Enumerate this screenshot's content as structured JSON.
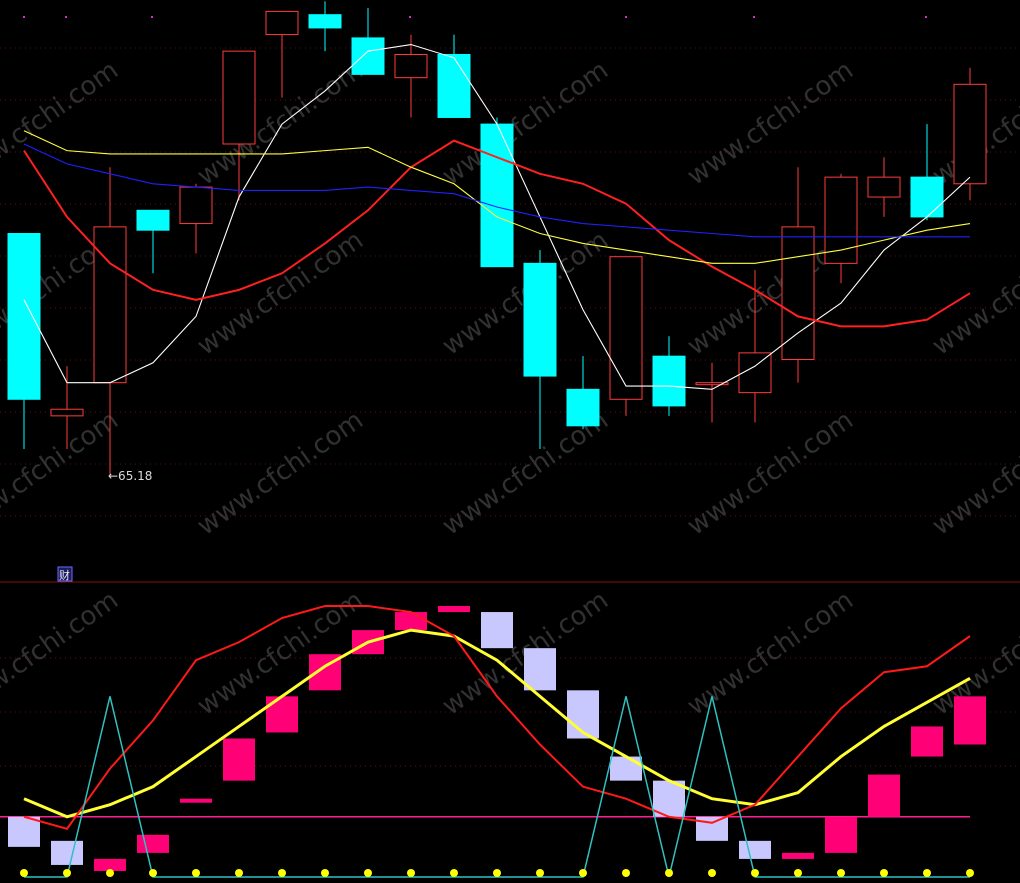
{
  "chart_data": [
    {
      "type": "candlestick",
      "annotation": "←65.18",
      "badge": "财",
      "low_marker": 65.18,
      "ylim": [
        62.2,
        79.0
      ],
      "up_color": "#ff3c3c",
      "down_color": "#00ffff",
      "candles": [
        {
          "o": 72.5,
          "h": 72.5,
          "l": 66.0,
          "c": 67.5
        },
        {
          "o": 67.0,
          "h": 68.5,
          "l": 66.0,
          "c": 67.2
        },
        {
          "o": 68.0,
          "h": 74.5,
          "l": 65.2,
          "c": 72.7
        },
        {
          "o": 73.2,
          "h": 73.2,
          "l": 71.3,
          "c": 72.6
        },
        {
          "o": 72.8,
          "h": 74.0,
          "l": 71.9,
          "c": 73.9
        },
        {
          "o": 75.2,
          "h": 76.4,
          "l": 73.5,
          "c": 78.0
        },
        {
          "o": 78.5,
          "h": 79.0,
          "l": 76.6,
          "c": 79.2
        },
        {
          "o": 79.1,
          "h": 79.5,
          "l": 78.0,
          "c": 78.7
        },
        {
          "o": 78.4,
          "h": 79.3,
          "l": 77.5,
          "c": 77.3
        },
        {
          "o": 77.2,
          "h": 78.5,
          "l": 76.0,
          "c": 77.9
        },
        {
          "o": 77.9,
          "h": 78.5,
          "l": 76.5,
          "c": 76.0
        },
        {
          "o": 75.8,
          "h": 76.0,
          "l": 71.5,
          "c": 71.5
        },
        {
          "o": 71.6,
          "h": 72.0,
          "l": 66.0,
          "c": 68.2
        },
        {
          "o": 67.8,
          "h": 68.8,
          "l": 66.6,
          "c": 66.7
        },
        {
          "o": 67.5,
          "h": 71.8,
          "l": 67.0,
          "c": 71.8
        },
        {
          "o": 68.8,
          "h": 69.4,
          "l": 67.0,
          "c": 67.3
        },
        {
          "o": 68.0,
          "h": 68.6,
          "l": 66.8,
          "c": 68.0
        },
        {
          "o": 67.7,
          "h": 71.4,
          "l": 66.8,
          "c": 68.9
        },
        {
          "o": 68.7,
          "h": 74.5,
          "l": 68.0,
          "c": 72.7
        },
        {
          "o": 71.6,
          "h": 74.3,
          "l": 71.0,
          "c": 74.2
        },
        {
          "o": 73.6,
          "h": 74.8,
          "l": 73.0,
          "c": 74.2
        },
        {
          "o": 74.2,
          "h": 75.8,
          "l": 72.9,
          "c": 73.0
        },
        {
          "o": 74.0,
          "h": 77.5,
          "l": 73.5,
          "c": 77.0
        }
      ],
      "series": [
        {
          "color": "#ffffff",
          "values": [
            70.5,
            68.0,
            68.0,
            68.6,
            70.0,
            73.6,
            75.8,
            76.8,
            78.0,
            78.2,
            77.8,
            75.8,
            73.0,
            70.2,
            67.9,
            67.9,
            67.8,
            68.5,
            69.5,
            70.4,
            72.0,
            73.0,
            74.2
          ]
        },
        {
          "color": "#ff2020",
          "values": [
            75.0,
            73.0,
            71.6,
            70.8,
            70.5,
            70.8,
            71.3,
            72.2,
            73.2,
            74.5,
            75.3,
            74.8,
            74.3,
            74.0,
            73.4,
            72.3,
            71.5,
            70.8,
            70.0,
            69.7,
            69.7,
            69.9,
            70.7
          ]
        },
        {
          "color": "#ffff40",
          "values": [
            75.6,
            75.0,
            74.9,
            74.9,
            74.9,
            74.9,
            74.9,
            75.0,
            75.1,
            74.5,
            74.0,
            73.0,
            72.5,
            72.2,
            72.0,
            71.8,
            71.6,
            71.6,
            71.8,
            72.0,
            72.3,
            72.6,
            72.8
          ]
        },
        {
          "color": "#2020ff",
          "values": [
            75.2,
            74.6,
            74.3,
            74.0,
            73.9,
            73.8,
            73.8,
            73.8,
            73.9,
            73.8,
            73.7,
            73.3,
            73.0,
            72.8,
            72.7,
            72.6,
            72.5,
            72.4,
            72.4,
            72.4,
            72.4,
            72.4,
            72.4
          ]
        }
      ]
    },
    {
      "type": "bar",
      "ylim": [
        -1.1,
        3.6
      ],
      "zero_line_color": "#ff1e96",
      "pos_color": "#ff0077",
      "neg_color": "#c8c8ff",
      "bars": [
        {
          "v": 0.0,
          "b": -0.5,
          "k": "neg"
        },
        {
          "v": -0.4,
          "b": -0.8,
          "k": "neg"
        },
        {
          "v": -0.7,
          "b": -0.9,
          "k": "pos"
        },
        {
          "v": -0.3,
          "b": -0.6,
          "k": "pos"
        },
        {
          "v": 0.3,
          "b": 0.3,
          "k": "pos"
        },
        {
          "v": 0.6,
          "b": 1.3,
          "k": "pos"
        },
        {
          "v": 1.4,
          "b": 2.0,
          "k": "pos"
        },
        {
          "v": 2.1,
          "b": 2.7,
          "k": "pos"
        },
        {
          "v": 2.7,
          "b": 3.1,
          "k": "pos"
        },
        {
          "v": 3.1,
          "b": 3.4,
          "k": "pos"
        },
        {
          "v": 3.4,
          "b": 3.5,
          "k": "pos"
        },
        {
          "v": 3.4,
          "b": 2.8,
          "k": "neg"
        },
        {
          "v": 2.8,
          "b": 2.1,
          "k": "neg"
        },
        {
          "v": 2.1,
          "b": 1.3,
          "k": "neg"
        },
        {
          "v": 1.0,
          "b": 0.6,
          "k": "neg"
        },
        {
          "v": 0.6,
          "b": 0.0,
          "k": "neg"
        },
        {
          "v": 0.0,
          "b": -0.4,
          "k": "neg"
        },
        {
          "v": -0.4,
          "b": -0.7,
          "k": "neg"
        },
        {
          "v": -0.6,
          "b": -0.7,
          "k": "pos"
        },
        {
          "v": -0.6,
          "b": 0.0,
          "k": "pos"
        },
        {
          "v": 0.0,
          "b": 0.7,
          "k": "pos"
        },
        {
          "v": 1.0,
          "b": 1.5,
          "k": "pos"
        },
        {
          "v": 1.2,
          "b": 2.0,
          "k": "pos"
        }
      ],
      "series": [
        {
          "color": "#ffff33",
          "values": [
            0.3,
            0.0,
            0.2,
            0.5,
            1.0,
            1.5,
            2.0,
            2.5,
            2.9,
            3.1,
            3.0,
            2.6,
            2.0,
            1.4,
            1.0,
            0.6,
            0.3,
            0.2,
            0.4,
            1.0,
            1.5,
            1.9,
            2.3
          ]
        },
        {
          "color": "#ff1a1a",
          "values": [
            0.0,
            -0.2,
            0.8,
            1.6,
            2.6,
            2.9,
            3.3,
            3.5,
            3.5,
            3.4,
            3.0,
            2.0,
            1.2,
            0.5,
            0.3,
            0.0,
            -0.1,
            0.2,
            1.0,
            1.8,
            2.4,
            2.5,
            3.0
          ]
        },
        {
          "color": "#30c0c0",
          "values": [
            -1.0,
            -1.0,
            2.0,
            -1.0,
            -1.0,
            -1.0,
            -1.0,
            -1.0,
            -1.0,
            -1.0,
            -1.0,
            -1.0,
            -1.0,
            -1.0,
            2.0,
            -1.0,
            2.0,
            -1.0,
            -1.0,
            -1.0,
            -1.0,
            -1.0,
            -1.0
          ]
        }
      ],
      "dot_color": "#ffff00"
    }
  ],
  "watermark": "www.cfchi.com"
}
